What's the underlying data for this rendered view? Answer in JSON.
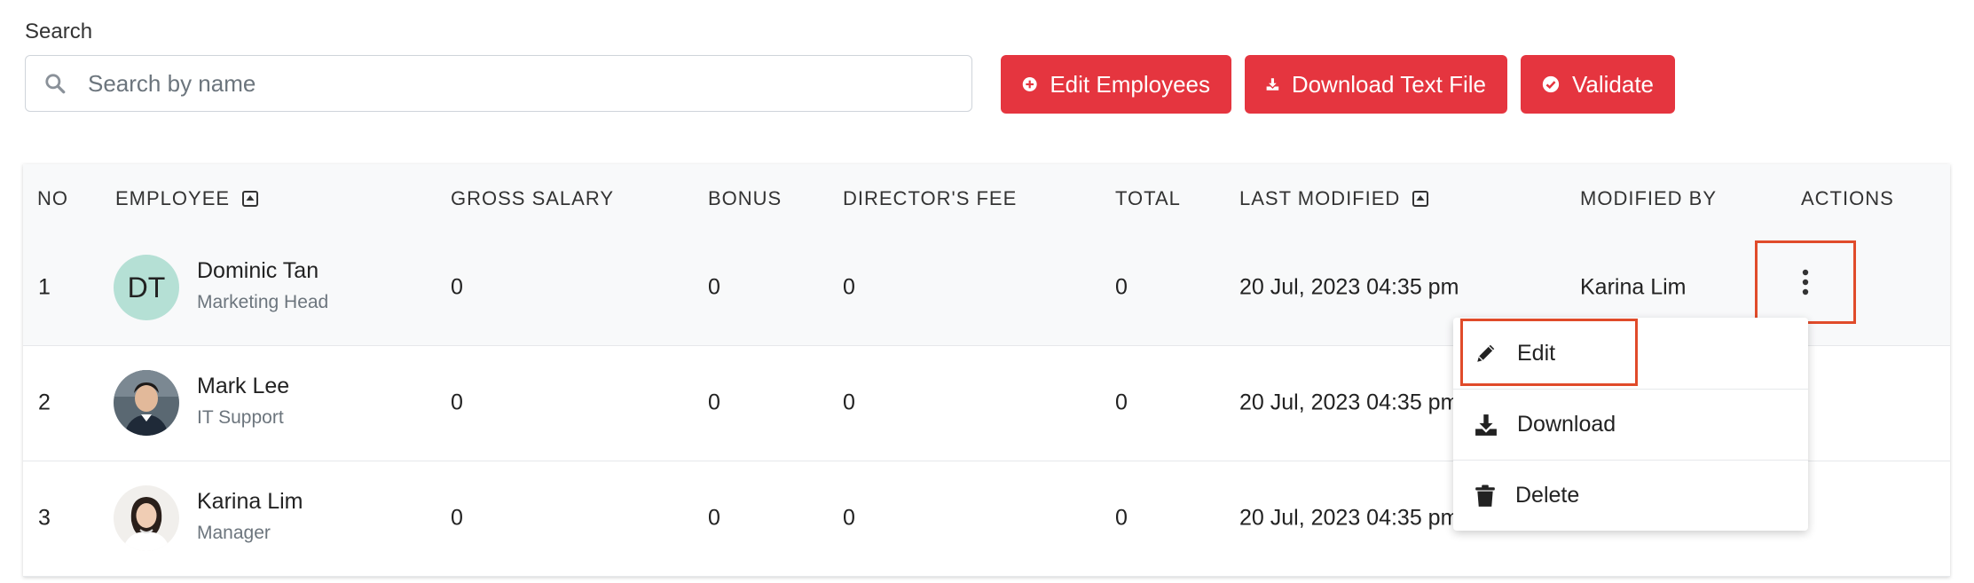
{
  "search": {
    "label": "Search",
    "placeholder": "Search by name",
    "value": ""
  },
  "toolbar": {
    "edit_employees_label": "Edit Employees",
    "download_text_label": "Download Text File",
    "validate_label": "Validate"
  },
  "colors": {
    "accent": "#e5353f",
    "highlight": "#e04b2a",
    "avatar_initials_bg": "#b5e0d5"
  },
  "table": {
    "columns": [
      "NO",
      "EMPLOYEE",
      "GROSS SALARY",
      "BONUS",
      "DIRECTOR'S FEE",
      "TOTAL",
      "LAST MODIFIED",
      "MODIFIED BY",
      "ACTIONS"
    ],
    "rows": [
      {
        "no": "1",
        "initials": "DT",
        "name": "Dominic Tan",
        "role": "Marketing Head",
        "gross": "0",
        "bonus": "0",
        "fee": "0",
        "total": "0",
        "modified": "20 Jul, 2023 04:35 pm",
        "by": "Karina Lim"
      },
      {
        "no": "2",
        "initials": "",
        "name": "Mark Lee",
        "role": "IT Support",
        "gross": "0",
        "bonus": "0",
        "fee": "0",
        "total": "0",
        "modified": "20 Jul, 2023 04:35 pm",
        "by": ""
      },
      {
        "no": "3",
        "initials": "",
        "name": "Karina Lim",
        "role": "Manager",
        "gross": "0",
        "bonus": "0",
        "fee": "0",
        "total": "0",
        "modified": "20 Jul, 2023 04:35 pm",
        "by": ""
      }
    ]
  },
  "action_menu": {
    "items": [
      {
        "label": "Edit",
        "icon": "pencil-icon"
      },
      {
        "label": "Download",
        "icon": "download-icon"
      },
      {
        "label": "Delete",
        "icon": "trash-icon"
      }
    ]
  }
}
